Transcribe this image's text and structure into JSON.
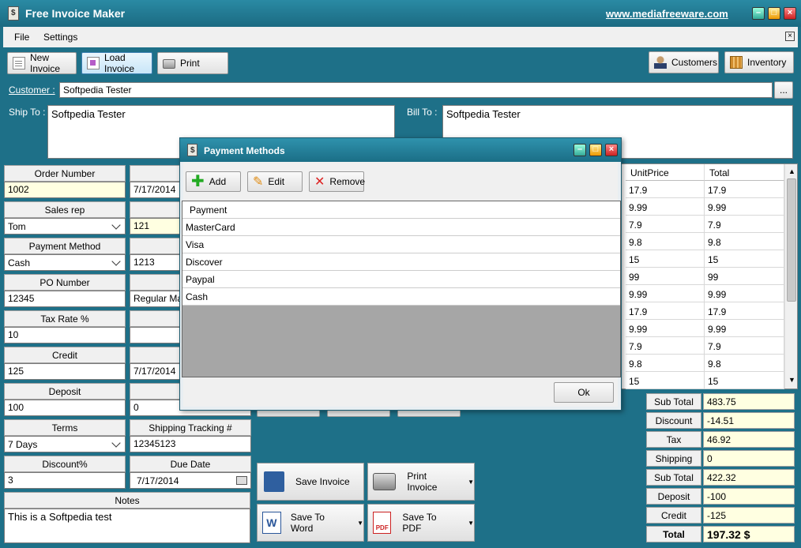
{
  "window": {
    "title": "Free Invoice Maker",
    "site_link": "www.mediafreeware.com"
  },
  "menu": [
    "File",
    "Settings"
  ],
  "toolbar": {
    "new_invoice": "New Invoice",
    "load_invoice": "Load Invoice",
    "print": "Print",
    "customers": "Customers",
    "inventory": "Inventory"
  },
  "customer": {
    "label": "Customer :",
    "value": "Softpedia Tester",
    "browse": "..."
  },
  "ship_to": {
    "label": "Ship To :",
    "value": "Softpedia Tester"
  },
  "bill_to": {
    "label": "Bill To :",
    "value": "Softpedia Tester"
  },
  "left_fields": {
    "order_number": {
      "label": "Order Number",
      "value": "1002"
    },
    "sales_rep": {
      "label": "Sales rep",
      "value": "Tom"
    },
    "payment_method": {
      "label": "Payment Method",
      "value": "Cash"
    },
    "po_number": {
      "label": "PO Number",
      "value": "12345"
    },
    "tax_rate": {
      "label": "Tax Rate %",
      "value": "10"
    },
    "credit": {
      "label": "Credit",
      "value": "125"
    },
    "deposit": {
      "label": "Deposit",
      "value": "100"
    },
    "terms": {
      "label": "Terms",
      "value": "7 Days"
    },
    "discount": {
      "label": "Discount%",
      "value": "3"
    },
    "notes": {
      "label": "Notes",
      "value": "This is a Softpedia test"
    }
  },
  "mid_fields": {
    "order_date": {
      "label": "Ord",
      "value": "7/17/2014"
    },
    "customer_id": {
      "label": "Custo",
      "value": "121"
    },
    "backorder": {
      "label": "BackO",
      "value": "1213"
    },
    "shipping": {
      "label": "Shipp",
      "value": "Regular Mail"
    },
    "package": {
      "label": "Packa",
      "value": ""
    },
    "ship_date": {
      "label": "Sh",
      "value": "7/17/2014"
    },
    "ship_other": {
      "label": "Sh",
      "value": "0"
    },
    "tracking": {
      "label": "Shipping Tracking #",
      "value": "12345123"
    },
    "due_date": {
      "label": "Due Date",
      "value": "7/17/2014"
    }
  },
  "grid": {
    "headers": [
      "UnitPrice",
      "Total"
    ],
    "rows": [
      [
        "17.9",
        "17.9"
      ],
      [
        "9.99",
        "9.99"
      ],
      [
        "7.9",
        "7.9"
      ],
      [
        "9.8",
        "9.8"
      ],
      [
        "15",
        "15"
      ],
      [
        "99",
        "99"
      ],
      [
        "9.99",
        "9.99"
      ],
      [
        "17.9",
        "17.9"
      ],
      [
        "9.99",
        "9.99"
      ],
      [
        "7.9",
        "7.9"
      ],
      [
        "9.8",
        "9.8"
      ],
      [
        "15",
        "15"
      ]
    ]
  },
  "totals": [
    {
      "label": "Sub Total",
      "value": "483.75"
    },
    {
      "label": "Discount",
      "value": "-14.51"
    },
    {
      "label": "Tax",
      "value": "46.92"
    },
    {
      "label": "Shipping",
      "value": "0"
    },
    {
      "label": "Sub Total",
      "value": "422.32"
    },
    {
      "label": "Deposit",
      "value": "-100"
    },
    {
      "label": "Credit",
      "value": "-125"
    },
    {
      "label": "Total",
      "value": "197.32 $"
    }
  ],
  "actions": {
    "save_invoice": "Save Invoice",
    "print_invoice": "Print Invoice",
    "save_word": "Save To Word",
    "save_pdf": "Save To PDF"
  },
  "dialog": {
    "title": "Payment Methods",
    "add": "Add",
    "edit": "Edit",
    "remove": "Remove",
    "column": "Payment",
    "items": [
      "MasterCard",
      "Visa",
      "Discover",
      "Paypal",
      "Cash"
    ],
    "ok": "Ok"
  },
  "colors": {
    "background": "#1e7088",
    "yellow_field": "#ffffe1"
  }
}
